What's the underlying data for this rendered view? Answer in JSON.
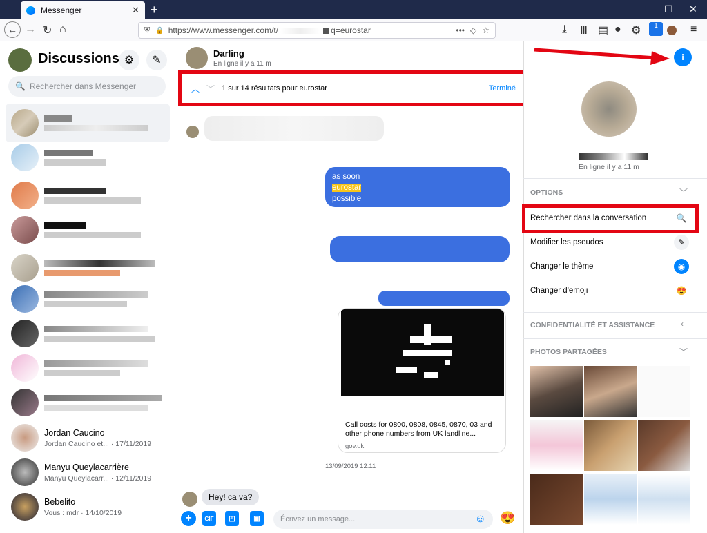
{
  "browser": {
    "tab_title": "Messenger",
    "url_prefix": "https://www.messenger.com/t/",
    "url_suffix": "q=eurostar",
    "badge": "1"
  },
  "sidebar": {
    "title": "Discussions",
    "search_placeholder": "Rechercher dans Messenger",
    "conversations": [
      {
        "name": "Jordan Caucino",
        "preview": "Jordan Caucino et... · 17/11/2019"
      },
      {
        "name": "Manyu Queylacarrière",
        "preview": "Manyu Queylacarr... · 12/11/2019"
      },
      {
        "name": "Bebelito",
        "preview": "Vous : mdr · 14/10/2019"
      }
    ]
  },
  "chat": {
    "name": "Darling",
    "status": "En ligne il y a 11 m",
    "find_result": "1 sur 14 résultats pour eurostar",
    "find_done": "Terminé",
    "bubble_lines": [
      "as soon",
      "eurostar",
      "possible"
    ],
    "link_title": "Call costs for 0800, 0808, 0845, 0870, 03 and other phone numbers from UK landline...",
    "link_domain": "gov.uk",
    "timestamp": "13/09/2019 12:11",
    "last_message": "Hey! ca va?",
    "composer_placeholder": "Écrivez un message...",
    "gif_label": "GIF"
  },
  "info_panel": {
    "status": "En ligne il y a 11 m",
    "options_header": "OPTIONS",
    "options": [
      "Rechercher dans la conversation",
      "Modifier les pseudos",
      "Changer le thème",
      "Changer d'emoji"
    ],
    "privacy_header": "CONFIDENTIALITÉ ET ASSISTANCE",
    "photos_header": "PHOTOS PARTAGÉES"
  },
  "colors": {
    "accent": "#0084ff",
    "highlight": "#e30613",
    "bubble": "#3b6fe0"
  }
}
